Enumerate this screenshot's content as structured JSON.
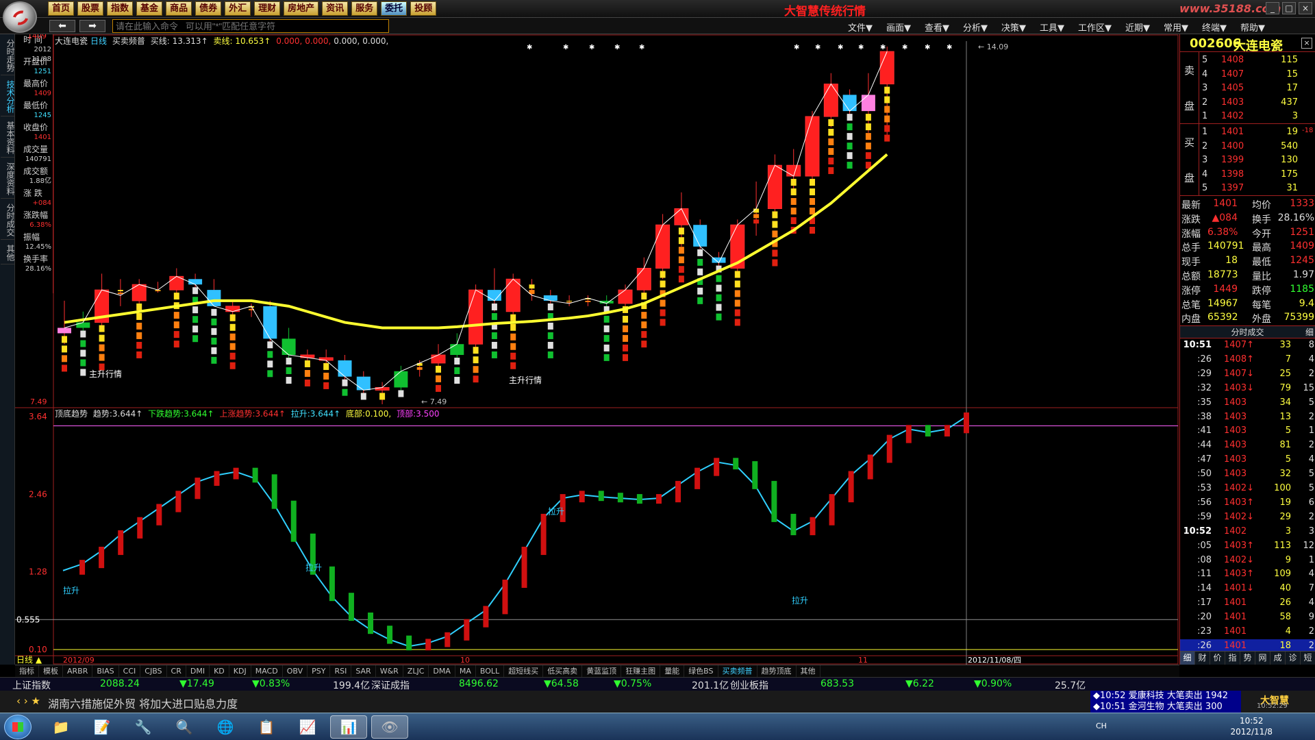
{
  "top_nav": [
    "首页",
    "股票",
    "指数",
    "基金",
    "商品",
    "债券",
    "外汇",
    "理财",
    "房地产",
    "资讯",
    "服务",
    "委托",
    "投顾"
  ],
  "top_nav_active_index": 11,
  "brand_title": "大智慧传统行情",
  "site_logo": "www.35188.com",
  "command_placeholder": "请在此输入命令   可以用\"*\"匹配任意字符",
  "menus": [
    "文件▼",
    "画面▼",
    "查看▼",
    "分析▼",
    "决策▼",
    "工具▼",
    "工作区▼",
    "近期▼",
    "常用▼",
    "终端▼",
    "帮助▼"
  ],
  "left_tabs": [
    {
      "label": "分时走势",
      "active": false
    },
    {
      "label": "技术分析",
      "active": true
    },
    {
      "label": "基本资料",
      "active": false
    },
    {
      "label": "深度资料",
      "active": false
    },
    {
      "label": "分时成交",
      "active": false
    },
    {
      "label": "其他",
      "active": false
    }
  ],
  "info_panel": [
    {
      "label": "时 间",
      "value": "2012",
      "value2": "11/08",
      "cls": "white"
    },
    {
      "label": "开盘价",
      "value": "1251",
      "cls": "cyan"
    },
    {
      "label": "最高价",
      "value": "1409",
      "cls": "red"
    },
    {
      "label": "最低价",
      "value": "1245",
      "cls": "cyan"
    },
    {
      "label": "收盘价",
      "value": "1401",
      "cls": "red"
    },
    {
      "label": "成交量",
      "value": "140791",
      "cls": "white"
    },
    {
      "label": "成交额",
      "value": "1.88亿",
      "cls": "white"
    },
    {
      "label": "涨 跌",
      "value": "+084",
      "cls": "red"
    },
    {
      "label": "涨跌幅",
      "value": "6.38%",
      "cls": "red"
    },
    {
      "label": "振幅",
      "value": "12.45%",
      "cls": "white"
    },
    {
      "label": "换手率",
      "value": "28.16%",
      "cls": "white"
    }
  ],
  "kline_header": {
    "name": "大连电瓷",
    "period": "日线",
    "indicator": "买卖频普",
    "buy_label": "买线:",
    "buy_value": "13.313↑",
    "sell_label": "卖线:",
    "sell_value": "10.653↑",
    "rest": [
      "0.000,",
      "0.000,",
      "0.000,",
      "0.000,"
    ]
  },
  "ind_header": {
    "name": "顶底趋势",
    "trend_label": "趋势:",
    "trend_value": "3.644↑",
    "down_label": "下跌趋势:",
    "down_value": "3.644↑",
    "up_label": "上涨趋势:",
    "up_value": "3.644↑",
    "pull_label": "拉升:",
    "pull_value": "3.644↑",
    "bottom_label": "底部:",
    "bottom_value": "0.100,",
    "top_label": "顶部:",
    "top_value": "3.500"
  },
  "kline_axis": {
    "top_label": "1409",
    "bottom_label": "7.49",
    "max_label": "14.09",
    "min_label": "7.49"
  },
  "kline_annotations": [
    "主升行情",
    "主升行情"
  ],
  "ind_axis": [
    "3.64",
    "2.46",
    "1.28",
    "0.555",
    "0.10"
  ],
  "ind_annotations": [
    "拉升",
    "拉升",
    "拉升",
    "拉升"
  ],
  "x_axis": [
    "2012/09",
    "10",
    "11"
  ],
  "cursor_date": "2012/11/08/四",
  "period_tab": "日线",
  "chart_data": [
    {
      "type": "candlestick",
      "title": "大连电瓷 日线 买卖频普",
      "ylim": [
        7.49,
        14.09
      ],
      "candles": [
        {
          "o": 8.8,
          "h": 9.4,
          "l": 8.6,
          "c": 8.9,
          "kind": "pink"
        },
        {
          "o": 8.9,
          "h": 9.2,
          "l": 8.8,
          "c": 9.0,
          "kind": "green"
        },
        {
          "o": 9.0,
          "h": 9.9,
          "l": 8.9,
          "c": 9.6,
          "kind": "red"
        },
        {
          "o": 9.6,
          "h": 9.8,
          "l": 9.3,
          "c": 9.5,
          "kind": "bar"
        },
        {
          "o": 9.4,
          "h": 9.8,
          "l": 9.3,
          "c": 9.7,
          "kind": "red"
        },
        {
          "o": 9.6,
          "h": 9.75,
          "l": 9.55,
          "c": 9.6,
          "kind": "bar"
        },
        {
          "o": 9.6,
          "h": 10.0,
          "l": 9.5,
          "c": 9.85,
          "kind": "red"
        },
        {
          "o": 9.8,
          "h": 9.9,
          "l": 9.6,
          "c": 9.7,
          "kind": "cyan"
        },
        {
          "o": 9.6,
          "h": 9.8,
          "l": 9.3,
          "c": 9.3,
          "kind": "cyan"
        },
        {
          "o": 9.3,
          "h": 9.4,
          "l": 9.1,
          "c": 9.2,
          "kind": "red"
        },
        {
          "o": 9.2,
          "h": 9.35,
          "l": 9.1,
          "c": 9.3,
          "kind": "bar"
        },
        {
          "o": 9.3,
          "h": 9.4,
          "l": 8.6,
          "c": 8.7,
          "kind": "cyan"
        },
        {
          "o": 8.7,
          "h": 8.9,
          "l": 8.3,
          "c": 8.4,
          "kind": "green"
        },
        {
          "o": 8.4,
          "h": 8.5,
          "l": 8.3,
          "c": 8.35,
          "kind": "red"
        },
        {
          "o": 8.35,
          "h": 8.5,
          "l": 8.2,
          "c": 8.3,
          "kind": "red"
        },
        {
          "o": 8.3,
          "h": 8.4,
          "l": 7.9,
          "c": 8.0,
          "kind": "cyan"
        },
        {
          "o": 8.0,
          "h": 8.1,
          "l": 7.6,
          "c": 7.75,
          "kind": "cyan"
        },
        {
          "o": 7.75,
          "h": 7.9,
          "l": 7.49,
          "c": 7.8,
          "kind": "red"
        },
        {
          "o": 7.8,
          "h": 8.2,
          "l": 7.7,
          "c": 8.1,
          "kind": "green"
        },
        {
          "o": 8.1,
          "h": 8.3,
          "l": 8.0,
          "c": 8.25,
          "kind": "bar"
        },
        {
          "o": 8.25,
          "h": 8.6,
          "l": 8.1,
          "c": 8.4,
          "kind": "red"
        },
        {
          "o": 8.4,
          "h": 8.8,
          "l": 8.3,
          "c": 8.6,
          "kind": "green"
        },
        {
          "o": 8.6,
          "h": 9.7,
          "l": 8.5,
          "c": 9.6,
          "kind": "red"
        },
        {
          "o": 9.6,
          "h": 10.0,
          "l": 9.2,
          "c": 9.4,
          "kind": "cyan"
        },
        {
          "o": 9.2,
          "h": 9.9,
          "l": 9.0,
          "c": 9.8,
          "kind": "red"
        },
        {
          "o": 9.7,
          "h": 9.8,
          "l": 9.4,
          "c": 9.5,
          "kind": "bar"
        },
        {
          "o": 9.5,
          "h": 9.6,
          "l": 9.35,
          "c": 9.4,
          "kind": "cyan"
        },
        {
          "o": 9.4,
          "h": 9.5,
          "l": 9.3,
          "c": 9.35,
          "kind": "bar"
        },
        {
          "o": 9.35,
          "h": 9.5,
          "l": 9.3,
          "c": 9.45,
          "kind": "bar"
        },
        {
          "o": 9.4,
          "h": 9.5,
          "l": 9.3,
          "c": 9.35,
          "kind": "green"
        },
        {
          "o": 9.35,
          "h": 9.7,
          "l": 9.3,
          "c": 9.6,
          "kind": "red"
        },
        {
          "o": 9.6,
          "h": 10.2,
          "l": 9.5,
          "c": 10.0,
          "kind": "red"
        },
        {
          "o": 10.0,
          "h": 11.0,
          "l": 9.8,
          "c": 10.8,
          "kind": "red"
        },
        {
          "o": 10.8,
          "h": 11.4,
          "l": 10.4,
          "c": 11.1,
          "kind": "red"
        },
        {
          "o": 10.8,
          "h": 10.9,
          "l": 10.3,
          "c": 10.4,
          "kind": "cyan"
        },
        {
          "o": 10.2,
          "h": 10.3,
          "l": 10.0,
          "c": 10.1,
          "kind": "cyan"
        },
        {
          "o": 10.0,
          "h": 10.9,
          "l": 9.9,
          "c": 10.8,
          "kind": "red"
        },
        {
          "o": 10.8,
          "h": 11.6,
          "l": 10.6,
          "c": 11.1,
          "kind": "bar"
        },
        {
          "o": 11.1,
          "h": 12.1,
          "l": 11.0,
          "c": 11.9,
          "kind": "red"
        },
        {
          "o": 11.9,
          "h": 12.2,
          "l": 11.4,
          "c": 11.7,
          "kind": "red"
        },
        {
          "o": 11.7,
          "h": 12.9,
          "l": 11.6,
          "c": 12.8,
          "kind": "red"
        },
        {
          "o": 12.8,
          "h": 13.6,
          "l": 12.6,
          "c": 13.4,
          "kind": "red"
        },
        {
          "o": 13.2,
          "h": 13.3,
          "l": 12.8,
          "c": 12.9,
          "kind": "cyan"
        },
        {
          "o": 12.9,
          "h": 13.6,
          "l": 12.5,
          "c": 13.2,
          "kind": "pink"
        },
        {
          "o": 13.4,
          "h": 14.09,
          "l": 12.4,
          "c": 14.0,
          "kind": "red"
        }
      ],
      "ma_line": [
        9.0,
        9.05,
        9.1,
        9.15,
        9.2,
        9.25,
        9.3,
        9.35,
        9.4,
        9.4,
        9.4,
        9.35,
        9.3,
        9.2,
        9.1,
        9.0,
        8.95,
        8.9,
        8.9,
        8.9,
        8.9,
        8.92,
        8.95,
        8.98,
        9.0,
        9.02,
        9.05,
        9.08,
        9.12,
        9.18,
        9.25,
        9.35,
        9.5,
        9.65,
        9.8,
        9.95,
        10.1,
        10.3,
        10.5,
        10.7,
        10.95,
        11.2,
        11.5,
        11.8,
        12.1
      ]
    },
    {
      "type": "line",
      "title": "顶底趋势",
      "ylim": [
        0.1,
        3.64
      ],
      "values": [
        1.3,
        1.4,
        1.6,
        1.85,
        2.05,
        2.25,
        2.45,
        2.65,
        2.75,
        2.8,
        2.7,
        2.3,
        1.8,
        1.3,
        0.9,
        0.6,
        0.4,
        0.25,
        0.15,
        0.2,
        0.3,
        0.5,
        0.7,
        1.1,
        1.6,
        2.1,
        2.4,
        2.45,
        2.42,
        2.4,
        2.38,
        2.4,
        2.6,
        2.8,
        2.95,
        2.9,
        2.6,
        2.1,
        1.9,
        2.05,
        2.4,
        2.75,
        3.0,
        3.3,
        3.45,
        3.4,
        3.45,
        3.64
      ],
      "reference_lines": [
        3.5,
        0.555,
        0.1
      ]
    }
  ],
  "stock": {
    "code": "002606",
    "name": "大连电瓷"
  },
  "sell_book": [
    {
      "lvl": "5",
      "price": "1408",
      "vol": "115"
    },
    {
      "lvl": "4",
      "price": "1407",
      "vol": "15"
    },
    {
      "lvl": "3",
      "price": "1405",
      "vol": "17"
    },
    {
      "lvl": "2",
      "price": "1403",
      "vol": "437"
    },
    {
      "lvl": "1",
      "price": "1402",
      "vol": "3"
    }
  ],
  "buy_book": [
    {
      "lvl": "1",
      "price": "1401",
      "vol": "19",
      "chg": "-18"
    },
    {
      "lvl": "2",
      "price": "1400",
      "vol": "540",
      "chg": ""
    },
    {
      "lvl": "3",
      "price": "1399",
      "vol": "130",
      "chg": ""
    },
    {
      "lvl": "4",
      "price": "1398",
      "vol": "175",
      "chg": ""
    },
    {
      "lvl": "5",
      "price": "1397",
      "vol": "31",
      "chg": ""
    }
  ],
  "book_labels": {
    "sell": [
      "卖",
      "盘"
    ],
    "buy": [
      "买",
      "盘"
    ]
  },
  "stats": [
    {
      "l1": "最新",
      "v1": "1401",
      "l2": "均价",
      "v2": "1333"
    },
    {
      "l1": "涨跌",
      "v1": "▲084",
      "l2": "换手",
      "v2": "28.16%"
    },
    {
      "l1": "涨幅",
      "v1": "6.38%",
      "l2": "今开",
      "v2": "1251"
    },
    {
      "l1": "总手",
      "v1": "140791",
      "l2": "最高",
      "v2": "1409"
    },
    {
      "l1": "现手",
      "v1": "18",
      "l2": "最低",
      "v2": "1245"
    },
    {
      "l1": "总额",
      "v1": "18773",
      "l2": "量比",
      "v2": "1.97"
    },
    {
      "l1": "涨停",
      "v1": "1449",
      "l2": "跌停",
      "v2": "1185"
    },
    {
      "l1": "总笔",
      "v1": "14967",
      "l2": "每笔",
      "v2": "9.4"
    },
    {
      "l1": "内盘",
      "v1": "65392",
      "l2": "外盘",
      "v2": "75399"
    }
  ],
  "tick_header": {
    "title": "分时成交",
    "detail": "细"
  },
  "ticks": [
    {
      "t": "10:51",
      "p": "1407↑",
      "v": "33",
      "n": "8",
      "big": true
    },
    {
      "t": ":26",
      "p": "1408↑",
      "v": "7",
      "n": "4"
    },
    {
      "t": ":29",
      "p": "1407↓",
      "v": "25",
      "n": "2"
    },
    {
      "t": ":32",
      "p": "1403↓",
      "v": "79",
      "n": "15"
    },
    {
      "t": ":35",
      "p": "1403",
      "v": "34",
      "n": "5"
    },
    {
      "t": ":38",
      "p": "1403",
      "v": "13",
      "n": "2"
    },
    {
      "t": ":41",
      "p": "1403",
      "v": "5",
      "n": "1"
    },
    {
      "t": ":44",
      "p": "1403",
      "v": "81",
      "n": "2"
    },
    {
      "t": ":47",
      "p": "1403",
      "v": "5",
      "n": "4"
    },
    {
      "t": ":50",
      "p": "1403",
      "v": "32",
      "n": "5"
    },
    {
      "t": ":53",
      "p": "1402↓",
      "v": "100",
      "n": "5"
    },
    {
      "t": ":56",
      "p": "1403↑",
      "v": "19",
      "n": "6"
    },
    {
      "t": ":59",
      "p": "1402↓",
      "v": "29",
      "n": "2"
    },
    {
      "t": "10:52",
      "p": "1402",
      "v": "3",
      "n": "3",
      "big": true
    },
    {
      "t": ":05",
      "p": "1403↑",
      "v": "113",
      "n": "12"
    },
    {
      "t": ":08",
      "p": "1402↓",
      "v": "9",
      "n": "1"
    },
    {
      "t": ":11",
      "p": "1403↑",
      "v": "109",
      "n": "4"
    },
    {
      "t": ":14",
      "p": "1401↓",
      "v": "40",
      "n": "7"
    },
    {
      "t": ":17",
      "p": "1401",
      "v": "26",
      "n": "4"
    },
    {
      "t": ":20",
      "p": "1401",
      "v": "58",
      "n": "9"
    },
    {
      "t": ":23",
      "p": "1401",
      "v": "4",
      "n": "2"
    },
    {
      "t": ":26",
      "p": "1401",
      "v": "18",
      "n": "2",
      "selected": true
    }
  ],
  "tick_tabs": [
    "细",
    "财",
    "价",
    "指",
    "势",
    "网",
    "成",
    "诊",
    "短"
  ],
  "indicator_tabs": [
    "指标",
    "模板",
    "ARBR",
    "BIAS",
    "CCI",
    "CJBS",
    "CR",
    "DMI",
    "KD",
    "KDJ",
    "MACD",
    "OBV",
    "PSY",
    "RSI",
    "SAR",
    "W&R",
    "ZLJC",
    "DMA",
    "MA",
    "BOLL",
    "超短线买",
    "低买高卖",
    "黄蓝监顶",
    "狂赚主图",
    "量能",
    "绿色BS",
    "买卖频普",
    "趋势顶底",
    "其他"
  ],
  "indicator_tabs_active": 26,
  "index_bar": {
    "name1": "上证指数",
    "v1": "2088.24",
    "c1": "▼17.49",
    "p1": "▼0.83%",
    "amt1": "199.4亿",
    "name2": "深证成指",
    "v2": "8496.62",
    "c2": "▼64.58",
    "p2": "▼0.75%",
    "amt2": "201.1亿",
    "name3": "创业板指",
    "v3": "683.53",
    "c3": "▼6.22",
    "p3": "▼0.90%",
    "amt3": "25.7亿"
  },
  "news": "湖南六措施促外贸 将加大进口贴息力度",
  "alerts": [
    {
      "time": "◆10:52",
      "name": "爱康科技",
      "action": "大笔卖出",
      "vol": "1942"
    },
    {
      "time": "◆10:51",
      "name": "金河生物",
      "action": "大笔卖出",
      "vol": "300"
    }
  ],
  "dzh_brand": "大智慧",
  "small_clock": "10:52:29",
  "taskbar": {
    "time": "10:52",
    "date": "2012/11/8",
    "lang": "CH"
  }
}
